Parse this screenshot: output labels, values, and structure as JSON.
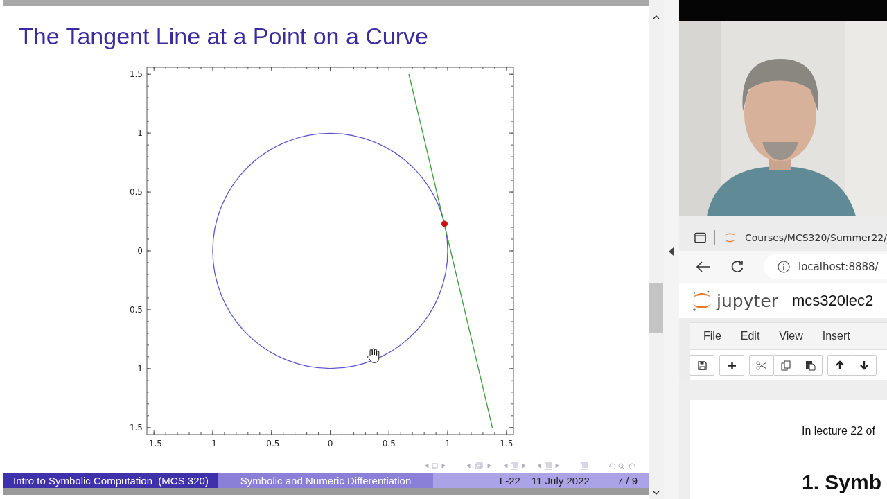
{
  "slide": {
    "title": "The Tangent Line at a Point on a Curve",
    "chart_data": {
      "type": "line",
      "xlim": [
        -1.56,
        1.56
      ],
      "ylim": [
        -1.56,
        1.56
      ],
      "xticks": [
        {
          "value": -1.5,
          "label": "-1.5"
        },
        {
          "value": -1,
          "label": "-1"
        },
        {
          "value": -0.5,
          "label": "-0.5"
        },
        {
          "value": 0,
          "label": "0"
        },
        {
          "value": 0.5,
          "label": "0.5"
        },
        {
          "value": 1,
          "label": "1"
        },
        {
          "value": 1.5,
          "label": "1.5"
        }
      ],
      "yticks": [
        {
          "value": -1.5,
          "label": "-1.5"
        },
        {
          "value": -1,
          "label": "-1"
        },
        {
          "value": -0.5,
          "label": "-0.5"
        },
        {
          "value": 0,
          "label": "0"
        },
        {
          "value": 0.5,
          "label": "0.5"
        },
        {
          "value": 1,
          "label": "1"
        },
        {
          "value": 1.5,
          "label": "1.5"
        }
      ],
      "series": [
        {
          "color": "#3c9a3c",
          "x": [
            0.67,
            1.38
          ],
          "values": [
            1.5,
            -1.5
          ]
        },
        {
          "color": "#cc1111",
          "marker": "o",
          "x": [
            0.973
          ],
          "values": [
            0.23
          ]
        }
      ]
    },
    "footer": {
      "course": "Intro to Symbolic Computation  (MCS 320)",
      "topic": "Symbolic and Numeric Differentiation",
      "lecture": "L-22",
      "date": "11 July 2022",
      "page": "7 / 9"
    }
  },
  "browser": {
    "tab_title": "Courses/MCS320/Summer22/",
    "address": "localhost:8888/"
  },
  "jupyter": {
    "logo": "jupyter",
    "notebook_name": "mcs320lec2",
    "menu": [
      "File",
      "Edit",
      "View",
      "Insert"
    ],
    "cell_text": "In lecture 22 of",
    "heading": "1. Symb"
  }
}
